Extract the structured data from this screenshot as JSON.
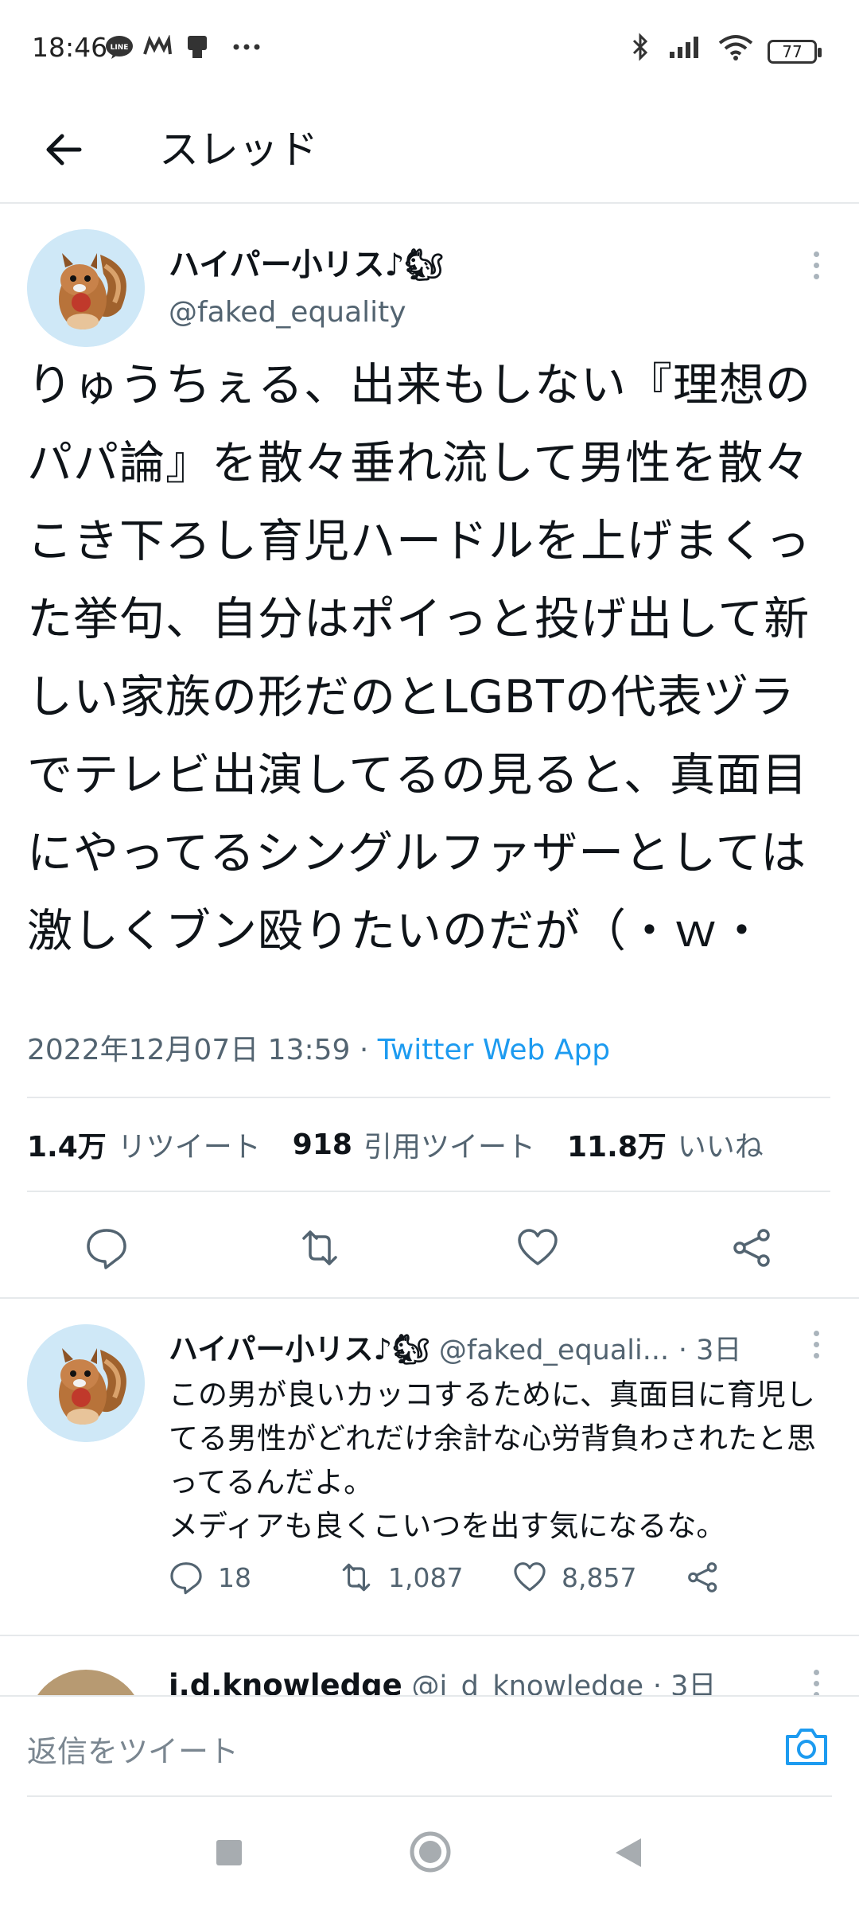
{
  "status_bar": {
    "time": "18:46",
    "battery": "77",
    "icons": [
      "line-icon",
      "m-app-icon",
      "podium-icon",
      "more-dots-icon",
      "bluetooth-icon",
      "signal-icon",
      "wifi-icon",
      "battery-icon"
    ]
  },
  "header": {
    "title": "スレッド",
    "back_icon": "back-arrow-icon"
  },
  "main_tweet": {
    "name": "ハイパー小リス♪🐿",
    "handle": "@faked_equality",
    "text": "りゅうちぇる、出来もしない『理想のパパ論』を散々垂れ流して男性を散々こき下ろし育児ハードルを上げまくった挙句、自分はポイっと投げ出して新しい家族の形だのとLGBTの代表ヅラでテレビ出演してるの見ると、真面目にやってるシングルファザーとしては激しくブン殴りたいのだが（・ｗ・",
    "timestamp": "2022年12月07日 13:59",
    "dot": "·",
    "source": "Twitter Web App",
    "stats": {
      "retweets_value": "1.4万",
      "retweets_label": "リツイート",
      "quotes_value": "918",
      "quotes_label": "引用ツイート",
      "likes_value": "11.8万",
      "likes_label": "いいね"
    }
  },
  "reply": {
    "name": "ハイパー小リス♪🐿",
    "handle": "@faked_equali...",
    "time": "· 3日",
    "text": "この男が良いカッコするために、真面目に育児してる男性がどれだけ余計な心労背負わされたと思ってるんだよ。\nメディアも良くこいつを出す気になるな。",
    "replies": "18",
    "retweets": "1,087",
    "likes": "8,857"
  },
  "next_reply": {
    "name": "i.d.knowledge",
    "handle": "@i_d_knowledge",
    "time": "· 3日"
  },
  "composer": {
    "placeholder": "返信をツイート",
    "camera_icon": "camera-icon"
  },
  "nav": {
    "icons": [
      "recent-apps-icon",
      "home-icon",
      "back-icon"
    ]
  },
  "colors": {
    "accent": "#1d9bf0",
    "text": "#0f1419",
    "secondary": "#536471",
    "divider": "#e6e9eb"
  }
}
